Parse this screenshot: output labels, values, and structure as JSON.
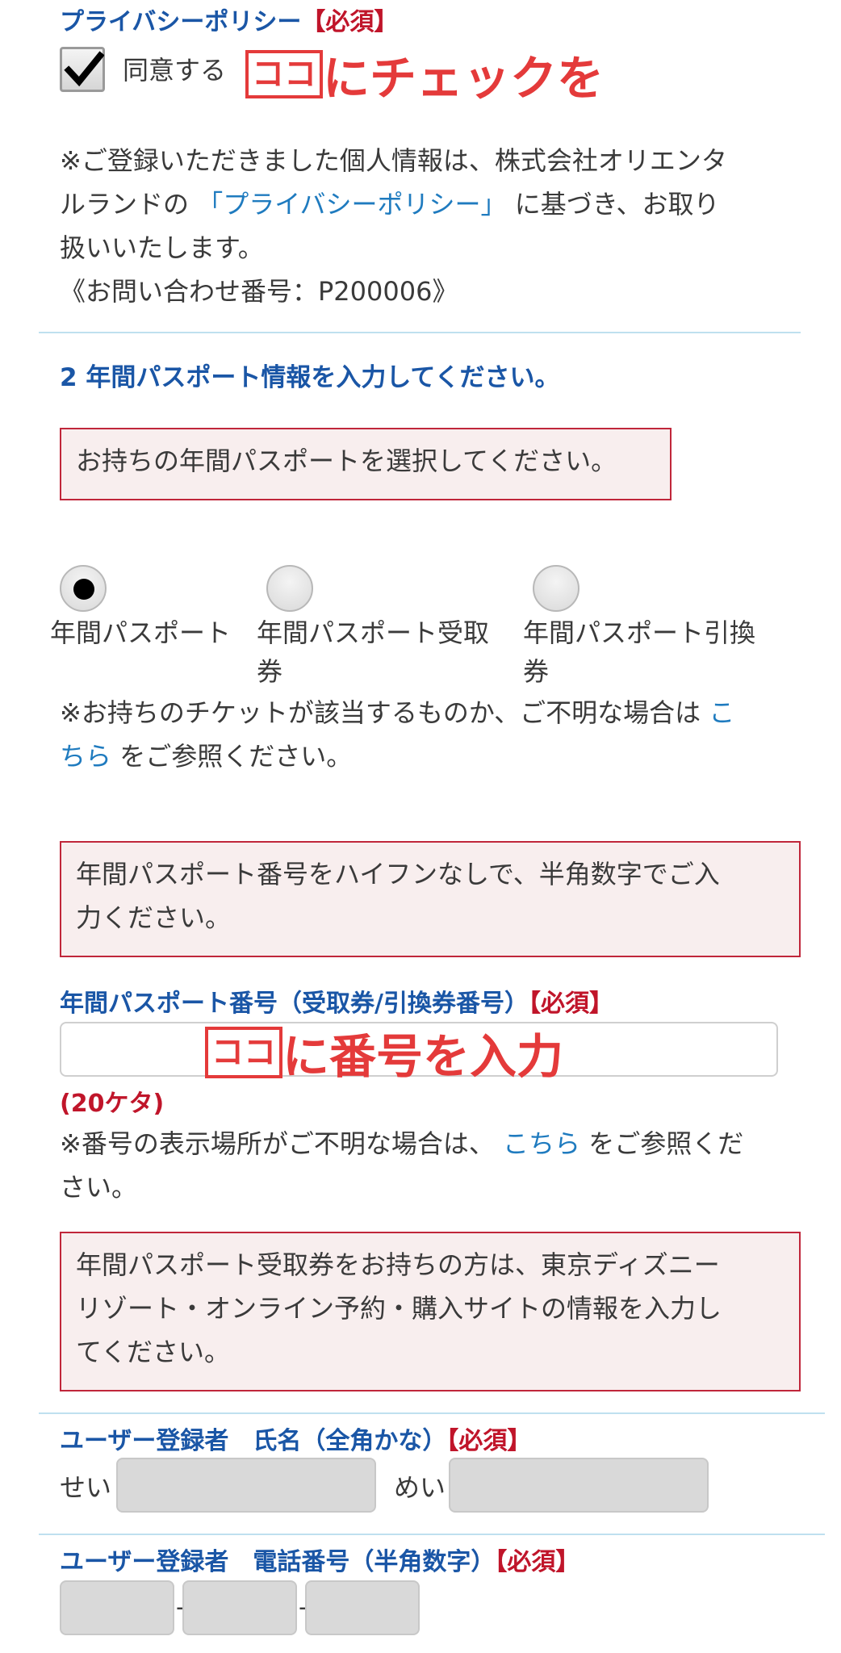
{
  "privacy": {
    "title": "プライバシーポリシー",
    "required": "【必須】",
    "agree_label": "同意する",
    "agree_checked": true,
    "annotation_koko": "ココ",
    "annotation_text": "にチェックを",
    "note_line1": "※ご登録いただきました個人情報は、株式会社オリエンタ",
    "note_line2_a": "ルランドの",
    "note_link": "「プライバシーポリシー」",
    "note_line2_b": "に基づき、お取り",
    "note_line3": "扱いいたします。",
    "inquiry": "《お問い合わせ番号：P200006》"
  },
  "section2": {
    "heading": "2 年間パスポート情報を入力してください。",
    "select_notice": "お持ちの年間パスポートを選択してください。",
    "radio_options": [
      {
        "line1": "年間パスポート",
        "line2": "",
        "selected": true
      },
      {
        "line1": "年間パスポート受取",
        "line2": "券",
        "selected": false
      },
      {
        "line1": "年間パスポート引換",
        "line2": "券",
        "selected": false
      }
    ],
    "ticket_note_a": "※お持ちのチケットが該当するものか、ご不明な場合は",
    "ticket_note_link_1": "こ",
    "ticket_note_link_2": "ちら",
    "ticket_note_b": "をご参照ください。"
  },
  "passport_number": {
    "notice_line1": "年間パスポート番号をハイフンなしで、半角数字でご入",
    "notice_line2": "力ください。",
    "label": "年間パスポート番号（受取券/引換券番号）",
    "required": "【必須】",
    "value": "",
    "annotation_koko": "ココ",
    "annotation_text": "に番号を入力",
    "digits_hint": "(20ケタ)",
    "location_note_a": "※番号の表示場所がご不明な場合は、",
    "location_note_link": "こちら",
    "location_note_b": "をご参照くだ",
    "location_note_c": "さい。"
  },
  "voucher_notice": {
    "line1": "年間パスポート受取券をお持ちの方は、東京ディズニー",
    "line2": "リゾート・オンライン予約・購入サイトの情報を入力し",
    "line3": "てください。"
  },
  "user_name": {
    "label": "ユーザー登録者　氏名（全角かな）",
    "required": "【必須】",
    "sei_label": "せい",
    "mei_label": "めい",
    "sei_value": "",
    "mei_value": ""
  },
  "user_phone": {
    "label": "ユーザー登録者　電話番号（半角数字）",
    "required": "【必須】",
    "separator": "-",
    "part1": "",
    "part2": "",
    "part3": ""
  },
  "colors": {
    "heading_blue": "#1a56a6",
    "required_red": "#c0152a",
    "link_blue": "#1f7bbf",
    "notice_border": "#c0263a",
    "notice_bg": "#f8eeee",
    "annotation_red": "#e43a3a"
  }
}
